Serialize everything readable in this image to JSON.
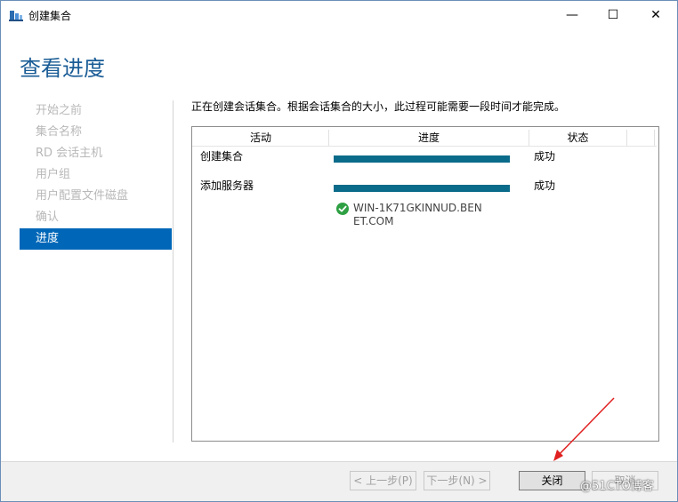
{
  "window": {
    "title": "创建集合",
    "controls": {
      "minimize": "—",
      "maximize": "☐",
      "close": "✕"
    }
  },
  "header": {
    "title": "查看进度"
  },
  "sidebar": {
    "items": [
      {
        "label": "开始之前",
        "active": false
      },
      {
        "label": "集合名称",
        "active": false
      },
      {
        "label": "RD 会话主机",
        "active": false
      },
      {
        "label": "用户组",
        "active": false
      },
      {
        "label": "用户配置文件磁盘",
        "active": false
      },
      {
        "label": "确认",
        "active": false
      },
      {
        "label": "进度",
        "active": true
      }
    ]
  },
  "main": {
    "intro": "正在创建会话集合。根据会话集合的大小，此过程可能需要一段时间才能完成。",
    "table": {
      "columns": [
        "活动",
        "进度",
        "状态"
      ],
      "rows": [
        {
          "activity": "创建集合",
          "progress": 1.0,
          "status": "成功"
        },
        {
          "activity": "添加服务器",
          "progress": 1.0,
          "status": "成功"
        }
      ],
      "server": {
        "name": "WIN-1K71GKINNUD.BENET.COM",
        "icon": "check-circle-icon",
        "color": "#2ea043"
      }
    }
  },
  "footer": {
    "prev_label": "< 上一步(P)",
    "next_label": "下一步(N) >",
    "close_label": "关闭",
    "cancel_label": "取消"
  },
  "watermark": "@51CTO博客",
  "colors": {
    "accent": "#0067b8",
    "progress_bar": "#0b6b8a",
    "header_text": "#1a5c96"
  }
}
